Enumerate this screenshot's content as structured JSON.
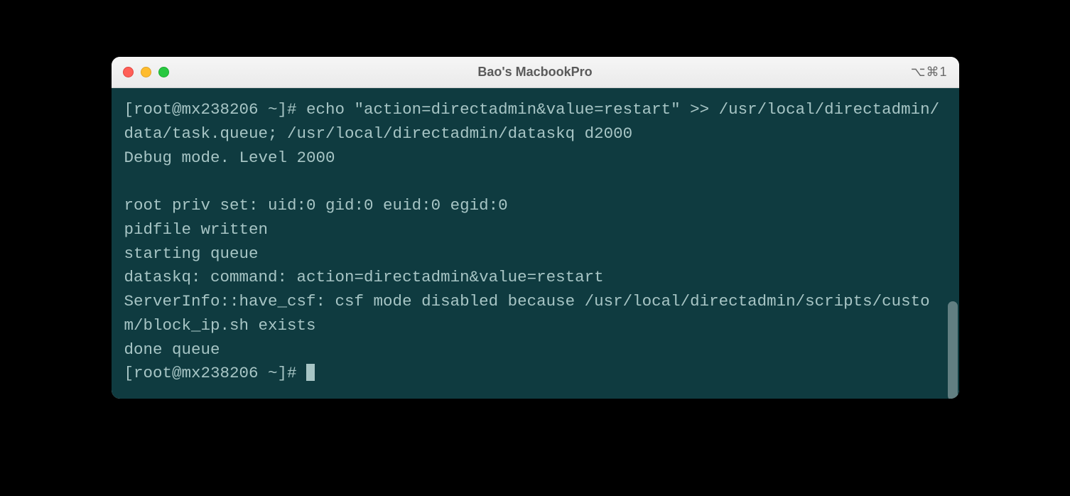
{
  "window": {
    "title": "Bao's MacbookPro",
    "shortcut": "⌥⌘1"
  },
  "terminal": {
    "lines": [
      "[root@mx238206 ~]# echo \"action=directadmin&value=restart\" >> /usr/local/directadmin/data/task.queue; /usr/local/directadmin/dataskq d2000",
      "Debug mode. Level 2000",
      "",
      "root priv set: uid:0 gid:0 euid:0 egid:0",
      "pidfile written",
      "starting queue",
      "dataskq: command: action=directadmin&value=restart",
      "ServerInfo::have_csf: csf mode disabled because /usr/local/directadmin/scripts/custom/block_ip.sh exists",
      "done queue"
    ],
    "prompt": "[root@mx238206 ~]# "
  }
}
